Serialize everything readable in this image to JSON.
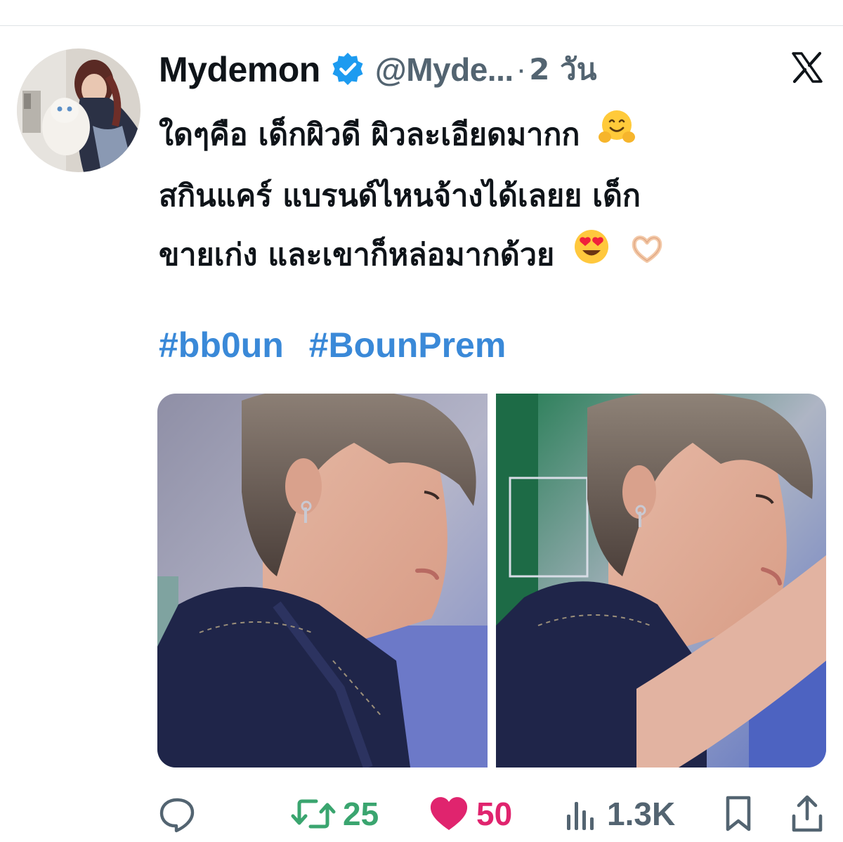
{
  "tweet": {
    "author": {
      "display_name": "Mydemon",
      "handle": "@Myde...",
      "verified": true,
      "avatar": "profile-photo"
    },
    "separator": "·",
    "time": "2 วัน",
    "platform_icon": "x-logo-icon",
    "text_lines": [
      "ใดๆคือ เด็กผิวดี ผิวละเอียดมากก",
      "สกินแคร์ แบรนด์ไหนจ้างได้เลยย เด็ก",
      "ขายเก่ง และเขาก็หล่อมากด้วย"
    ],
    "emojis": {
      "line1": "hugging-face-emoji",
      "line3": [
        "heart-eyes-emoji",
        "heart-hands-emoji"
      ]
    },
    "hashtags": [
      "#bb0un",
      "#BounPrem"
    ],
    "media": [
      "photo-1",
      "photo-2"
    ],
    "actions": {
      "reply": {
        "icon": "reply-icon",
        "count": ""
      },
      "retweet": {
        "icon": "retweet-icon",
        "count": "25",
        "color": "#3aa56f"
      },
      "like": {
        "icon": "heart-icon",
        "count": "50",
        "color": "#e0246e"
      },
      "views": {
        "icon": "views-icon",
        "count": "1.3K"
      },
      "bookmark": {
        "icon": "bookmark-icon"
      },
      "share": {
        "icon": "share-icon"
      }
    },
    "colors": {
      "link": "#3a89d8",
      "verified": "#1d9bf0",
      "secondary_text": "#536471"
    }
  }
}
